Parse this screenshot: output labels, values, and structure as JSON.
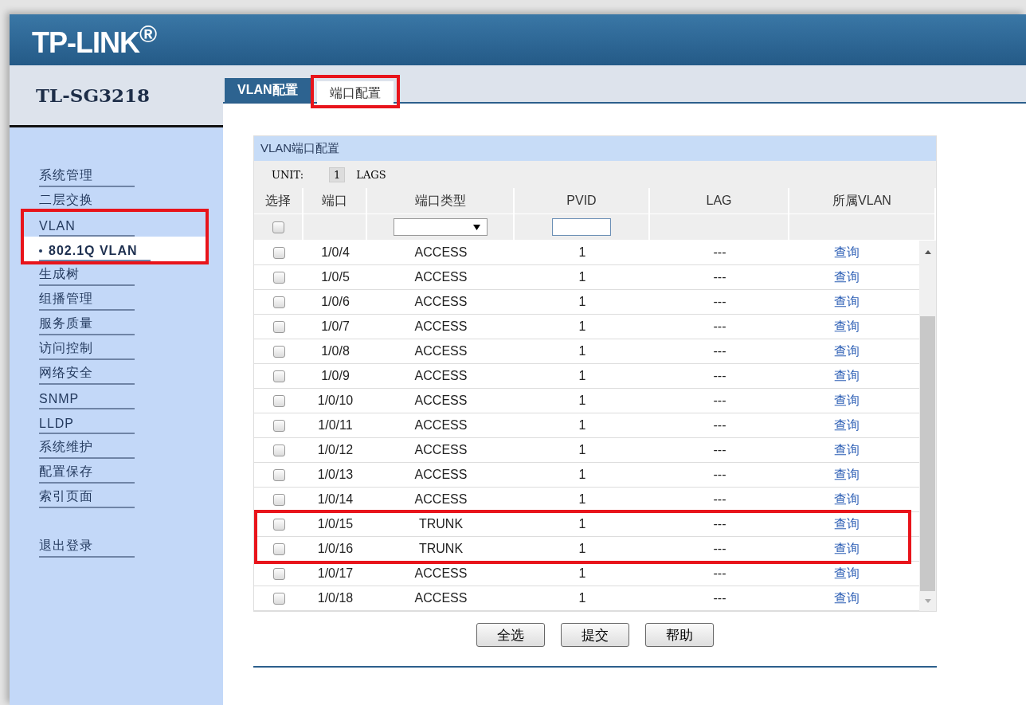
{
  "header": {
    "logo": "TP-LINK$^{®}$"
  },
  "device": {
    "model": "TL-SG3218"
  },
  "sidebar": {
    "items": [
      {
        "label": "系统管理",
        "selected": false,
        "highlighted": false
      },
      {
        "label": "二层交换",
        "selected": false,
        "highlighted": false
      },
      {
        "label": "VLAN",
        "selected": false,
        "highlighted": true,
        "children": [
          {
            "label": "802.1Q VLAN",
            "selected": true
          }
        ]
      },
      {
        "label": "生成树",
        "selected": false,
        "highlighted": false
      },
      {
        "label": "组播管理",
        "selected": false,
        "highlighted": false
      },
      {
        "label": "服务质量",
        "selected": false,
        "highlighted": false
      },
      {
        "label": "访问控制",
        "selected": false,
        "highlighted": false
      },
      {
        "label": "网络安全",
        "selected": false,
        "highlighted": false
      },
      {
        "label": "SNMP",
        "selected": false,
        "highlighted": false
      },
      {
        "label": "LLDP",
        "selected": false,
        "highlighted": false
      },
      {
        "label": "系统维护",
        "selected": false,
        "highlighted": false
      },
      {
        "label": "配置保存",
        "selected": false,
        "highlighted": false
      },
      {
        "label": "索引页面",
        "selected": false,
        "highlighted": false
      }
    ],
    "logout": {
      "label": "退出登录"
    }
  },
  "tabs": [
    {
      "label": "VLAN配置",
      "selected": false,
      "highlighted": false
    },
    {
      "label": "端口配置",
      "selected": true,
      "highlighted": true
    }
  ],
  "panel": {
    "title": "VLAN端口配置",
    "unit_label": "UNIT:",
    "unit_value": "1",
    "lags_label": "LAGS"
  },
  "table": {
    "columns": [
      "选择",
      "端口",
      "端口类型",
      "PVID",
      "LAG",
      "所属VLAN"
    ],
    "filter": {
      "checked": false
    },
    "rows": [
      {
        "port": "1/0/4",
        "type": "ACCESS",
        "pvid": "1",
        "lag": "---",
        "vlan": "查询",
        "checked": false,
        "highlighted": false
      },
      {
        "port": "1/0/5",
        "type": "ACCESS",
        "pvid": "1",
        "lag": "---",
        "vlan": "查询",
        "checked": false,
        "highlighted": false
      },
      {
        "port": "1/0/6",
        "type": "ACCESS",
        "pvid": "1",
        "lag": "---",
        "vlan": "查询",
        "checked": false,
        "highlighted": false
      },
      {
        "port": "1/0/7",
        "type": "ACCESS",
        "pvid": "1",
        "lag": "---",
        "vlan": "查询",
        "checked": false,
        "highlighted": false
      },
      {
        "port": "1/0/8",
        "type": "ACCESS",
        "pvid": "1",
        "lag": "---",
        "vlan": "查询",
        "checked": false,
        "highlighted": false
      },
      {
        "port": "1/0/9",
        "type": "ACCESS",
        "pvid": "1",
        "lag": "---",
        "vlan": "查询",
        "checked": false,
        "highlighted": false
      },
      {
        "port": "1/0/10",
        "type": "ACCESS",
        "pvid": "1",
        "lag": "---",
        "vlan": "查询",
        "checked": false,
        "highlighted": false
      },
      {
        "port": "1/0/11",
        "type": "ACCESS",
        "pvid": "1",
        "lag": "---",
        "vlan": "查询",
        "checked": false,
        "highlighted": false
      },
      {
        "port": "1/0/12",
        "type": "ACCESS",
        "pvid": "1",
        "lag": "---",
        "vlan": "查询",
        "checked": false,
        "highlighted": false
      },
      {
        "port": "1/0/13",
        "type": "ACCESS",
        "pvid": "1",
        "lag": "---",
        "vlan": "查询",
        "checked": false,
        "highlighted": false
      },
      {
        "port": "1/0/14",
        "type": "ACCESS",
        "pvid": "1",
        "lag": "---",
        "vlan": "查询",
        "checked": false,
        "highlighted": false
      },
      {
        "port": "1/0/15",
        "type": "TRUNK",
        "pvid": "1",
        "lag": "---",
        "vlan": "查询",
        "checked": false,
        "highlighted": true
      },
      {
        "port": "1/0/16",
        "type": "TRUNK",
        "pvid": "1",
        "lag": "---",
        "vlan": "查询",
        "checked": false,
        "highlighted": true
      },
      {
        "port": "1/0/17",
        "type": "ACCESS",
        "pvid": "1",
        "lag": "---",
        "vlan": "查询",
        "checked": false,
        "highlighted": false
      },
      {
        "port": "1/0/18",
        "type": "ACCESS",
        "pvid": "1",
        "lag": "---",
        "vlan": "查询",
        "checked": false,
        "highlighted": false
      }
    ]
  },
  "buttons": [
    "全选",
    "提交",
    "帮助"
  ]
}
